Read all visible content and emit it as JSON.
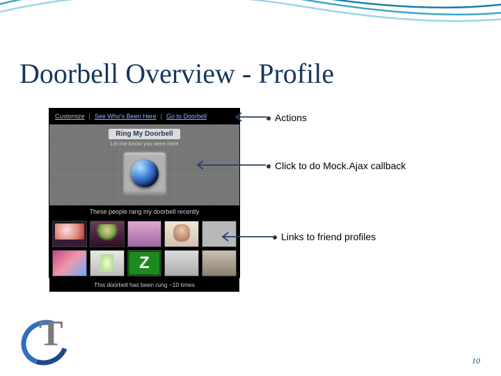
{
  "slide": {
    "title": "Doorbell Overview - Profile",
    "page_number": "10"
  },
  "callouts": {
    "actions": "Actions",
    "mockajax": "Click to do Mock.Ajax callback",
    "friends": "Links to friend profiles"
  },
  "screenshot": {
    "topbar": {
      "customize": "Customize",
      "who": "See Who's Been Here",
      "go": "Go to Doorbell"
    },
    "ring_label": "Ring My Doorbell",
    "ring_sub": "Let me know you were here",
    "recent_label": "These people rang my doorbell recently",
    "z_tile": "Z",
    "footer": "This doorbell has been rung ~10 times"
  },
  "logo": {
    "letter": "T"
  }
}
